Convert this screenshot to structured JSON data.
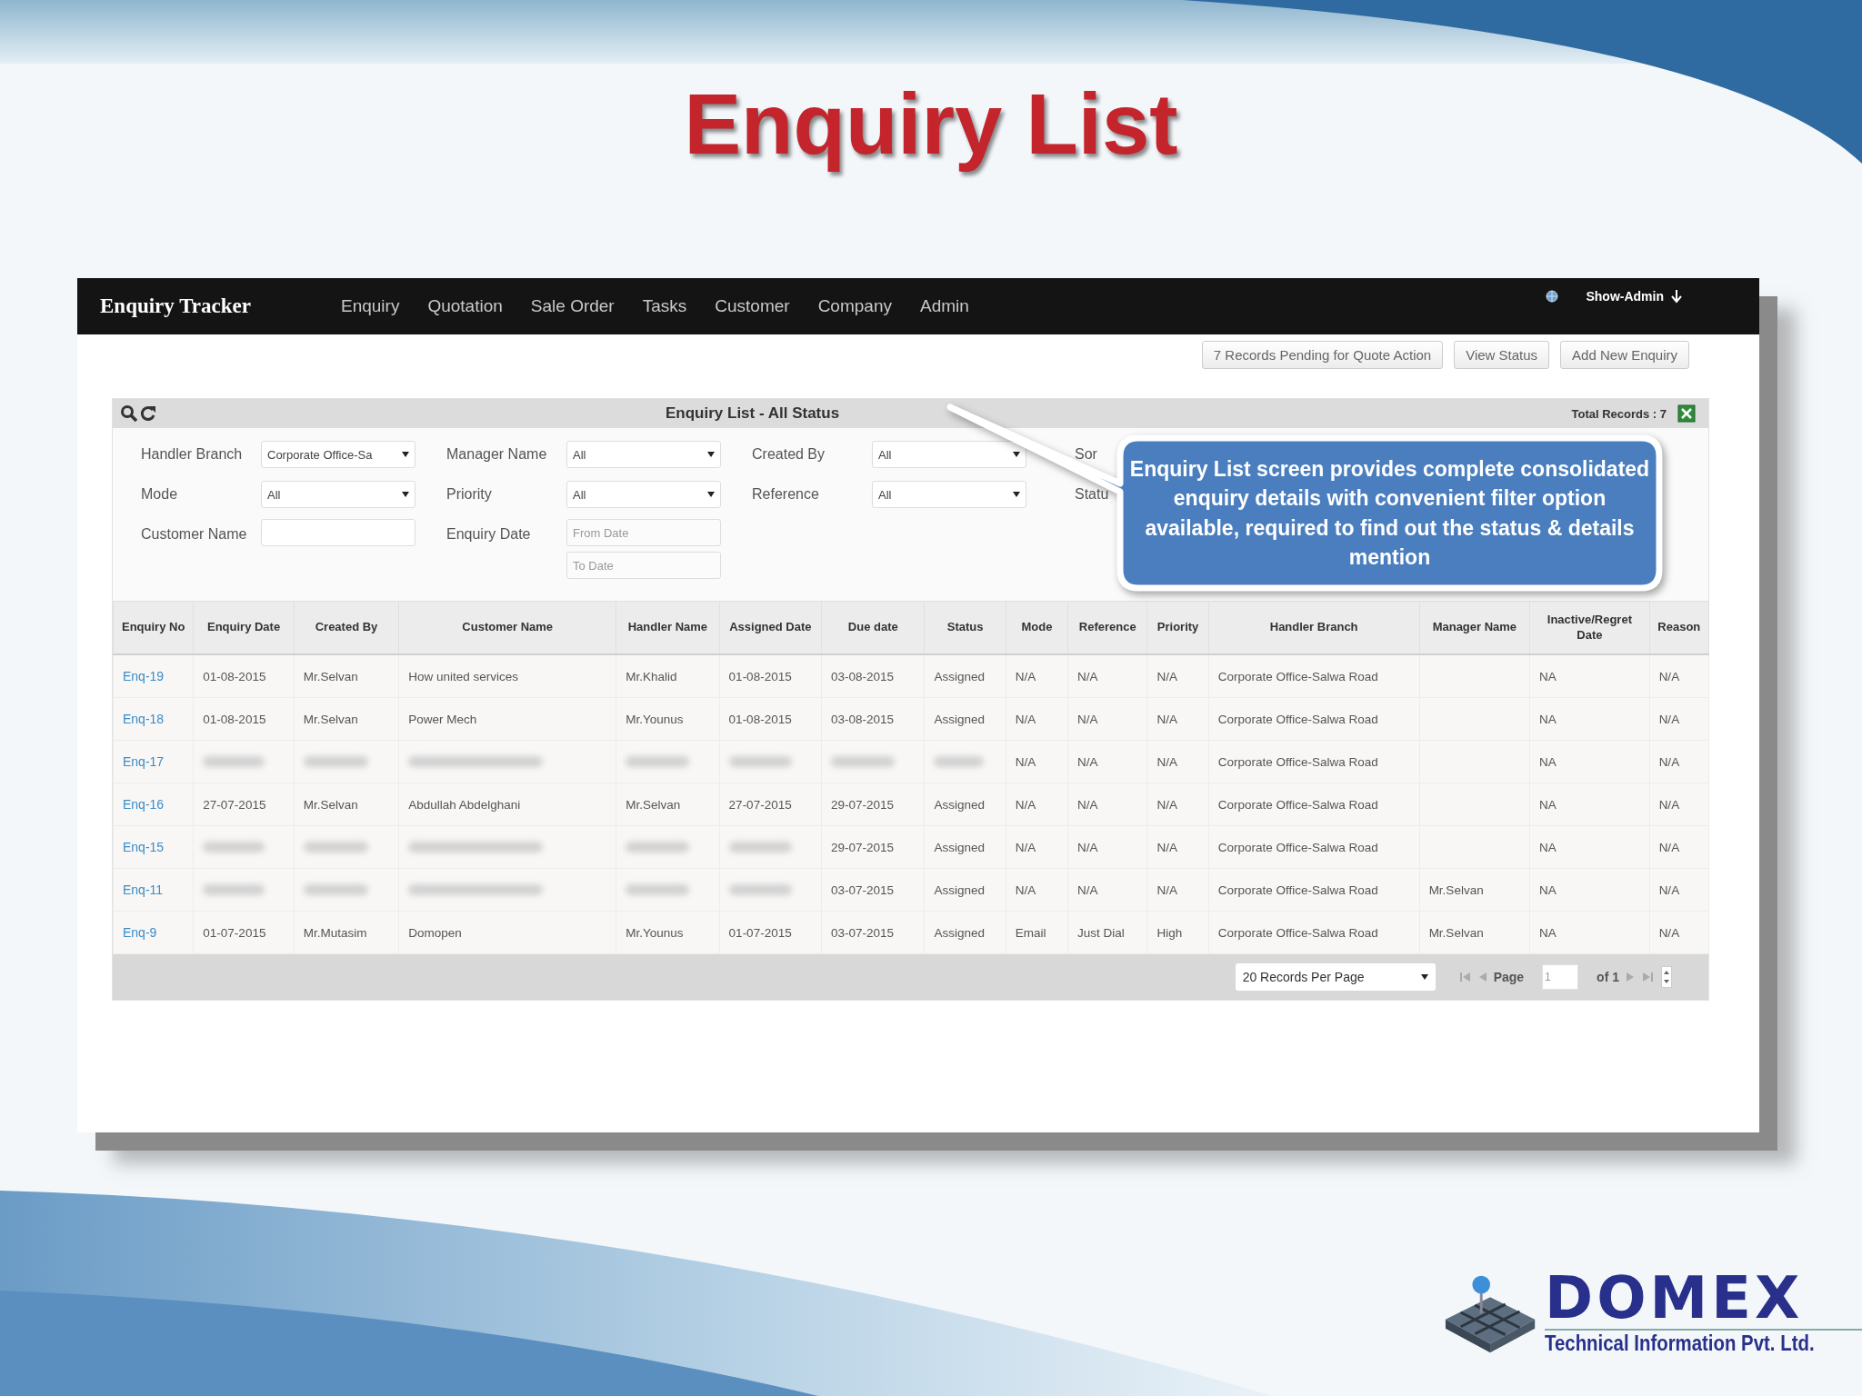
{
  "slide_title": "Enquiry List",
  "app": {
    "brand": "Enquiry Tracker",
    "nav": [
      "Enquiry",
      "Quotation",
      "Sale Order",
      "Tasks",
      "Customer",
      "Company",
      "Admin"
    ],
    "user": "Show-Admin"
  },
  "actions": [
    "7 Records Pending for Quote Action",
    "View Status",
    "Add New Enquiry"
  ],
  "panel": {
    "title": "Enquiry List - All Status",
    "total": "Total Records : 7"
  },
  "filters": [
    [
      {
        "label": "Handler Branch",
        "kind": "select",
        "value": "Corporate Office-Sa"
      },
      {
        "label": "Manager Name",
        "kind": "select",
        "value": "All"
      },
      {
        "label": "Created By",
        "kind": "select",
        "value": "All"
      },
      {
        "label": "Sor",
        "kind": "label"
      }
    ],
    [
      {
        "label": "Mode",
        "kind": "select",
        "value": "All"
      },
      {
        "label": "Priority",
        "kind": "select",
        "value": "All"
      },
      {
        "label": "Reference",
        "kind": "select",
        "value": "All"
      },
      {
        "label": "Statu",
        "kind": "label"
      }
    ],
    [
      {
        "label": "Customer Name",
        "kind": "text"
      },
      {
        "label": "Enquiry Date",
        "kind": "range",
        "placeholders": [
          "From Date",
          "To Date"
        ]
      }
    ]
  ],
  "table": {
    "columns": [
      "Enquiry No",
      "Enquiry Date",
      "Created By",
      "Customer Name",
      "Handler Name",
      "Assigned Date",
      "Due date",
      "Status",
      "Mode",
      "Reference",
      "Priority",
      "Handler Branch",
      "Manager Name",
      "Inactive/Regret Date",
      "Reason"
    ],
    "rows": [
      [
        "Enq-19",
        "01-08-2015",
        "Mr.Selvan",
        "How united services",
        "Mr.Khalid",
        "01-08-2015",
        "03-08-2015",
        "Assigned",
        "N/A",
        "N/A",
        "N/A",
        "Corporate Office-Salwa Road",
        null,
        "NA",
        "N/A"
      ],
      [
        "Enq-18",
        "01-08-2015",
        "Mr.Selvan",
        "Power Mech",
        "Mr.Younus",
        "01-08-2015",
        "03-08-2015",
        "Assigned",
        "N/A",
        "N/A",
        "N/A",
        "Corporate Office-Salwa Road",
        null,
        "NA",
        "N/A"
      ],
      [
        "Enq-17",
        {
          "kind": "blurred"
        },
        {
          "kind": "blurred"
        },
        {
          "kind": "blurred"
        },
        {
          "kind": "blurred"
        },
        {
          "kind": "blurred"
        },
        {
          "kind": "blurred"
        },
        {
          "kind": "blurred"
        },
        "N/A",
        "N/A",
        "N/A",
        "Corporate Office-Salwa Road",
        null,
        "NA",
        "N/A"
      ],
      [
        "Enq-16",
        "27-07-2015",
        "Mr.Selvan",
        "Abdullah Abdelghani",
        "Mr.Selvan",
        "27-07-2015",
        "29-07-2015",
        "Assigned",
        "N/A",
        "N/A",
        "N/A",
        "Corporate Office-Salwa Road",
        null,
        "NA",
        "N/A"
      ],
      [
        "Enq-15",
        {
          "kind": "blurred"
        },
        {
          "kind": "blurred"
        },
        {
          "kind": "blurred"
        },
        {
          "kind": "blurred"
        },
        {
          "kind": "blurred"
        },
        "29-07-2015",
        "Assigned",
        "N/A",
        "N/A",
        "N/A",
        "Corporate Office-Salwa Road",
        null,
        "NA",
        "N/A"
      ],
      [
        "Enq-11",
        {
          "kind": "blurred"
        },
        {
          "kind": "blurred"
        },
        {
          "kind": "blurred"
        },
        {
          "kind": "blurred"
        },
        {
          "kind": "blurred"
        },
        "03-07-2015",
        "Assigned",
        "N/A",
        "N/A",
        "N/A",
        "Corporate Office-Salwa Road",
        "Mr.Selvan",
        "NA",
        "N/A"
      ],
      [
        "Enq-9",
        "01-07-2015",
        "Mr.Mutasim",
        "Domopen",
        "Mr.Younus",
        "01-07-2015",
        "03-07-2015",
        "Assigned",
        "Email",
        "Just Dial",
        "High",
        "Corporate Office-Salwa Road",
        "Mr.Selvan",
        "NA",
        "N/A"
      ]
    ]
  },
  "pager": {
    "page_size": "20 Records Per Page",
    "page_label": "Page",
    "page": "1",
    "of": "of 1"
  },
  "callout": "Enquiry List screen provides complete consolidated enquiry details with convenient filter option available, required to find out the status & details mention",
  "logo": {
    "name": "DOMEX",
    "tagline": "Technical Information Pvt. Ltd."
  }
}
